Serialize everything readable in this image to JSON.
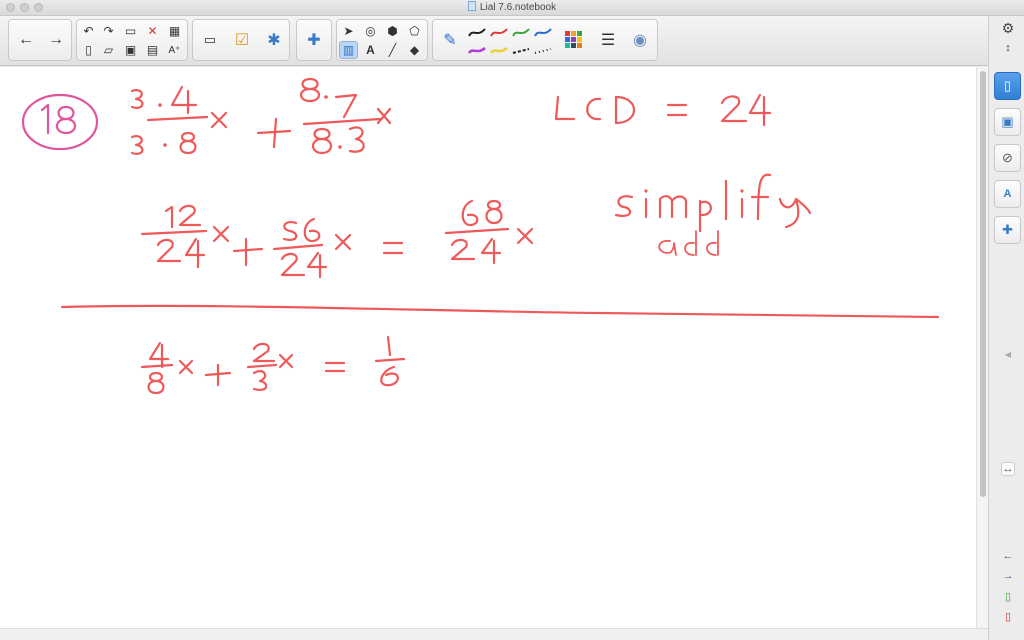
{
  "window": {
    "title": "Lial 7.6.notebook"
  },
  "toolbar": {
    "nav": [
      "back-arrow-icon",
      "forward-arrow-icon"
    ],
    "file_tools": [
      "undo-icon",
      "redo-icon",
      "clear-page-icon",
      "delete-icon",
      "insert-table-icon",
      "new-page-icon",
      "open-file-icon",
      "save-icon",
      "screen-shade-icon",
      "text-size-icon"
    ],
    "select_tools": [
      "select-arrow-icon",
      "shapes-icon",
      "fill-icon",
      "eraser-icon",
      "adjust-icon",
      "text-tool-icon",
      "line-tool-icon",
      "eraser-tool-icon"
    ],
    "pen_colors": [
      "#222222",
      "#e23b3b",
      "#3aa53a",
      "#2b6cd6",
      "#b23ad6",
      "#e8d23a",
      "#222222",
      "#222222"
    ],
    "palette_colors": [
      "#e23b3b",
      "#f0a030",
      "#3aa53a",
      "#2b6cd6",
      "#8e44ad",
      "#f1c40f",
      "#1abc9c",
      "#34495e",
      "#e67e22"
    ]
  },
  "side_panel": {
    "tabs": [
      "page-sorter-icon",
      "gallery-icon",
      "attachments-icon",
      "properties-icon",
      "addons-icon"
    ],
    "active": "page-sorter-icon"
  },
  "ink_colors": {
    "red": "#ee5a5a",
    "pink": "#e0569c"
  }
}
